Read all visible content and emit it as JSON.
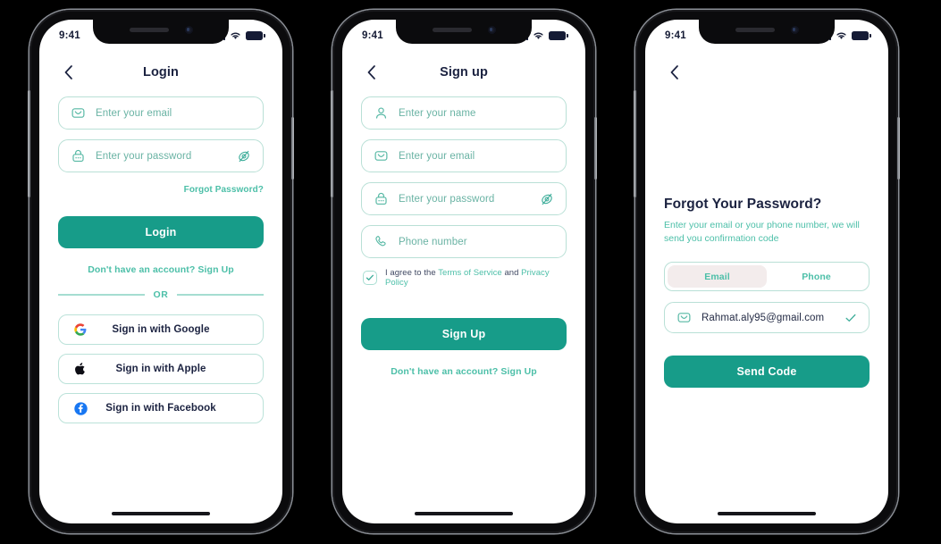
{
  "status_bar": {
    "time": "9:41",
    "signal_icon": "cellular-bars-icon",
    "wifi_icon": "wifi-icon",
    "battery_icon": "battery-icon"
  },
  "colors": {
    "primary": "#179C89",
    "link": "#4CBFA8",
    "placeholder": "#6AB3A4",
    "border": "#B9E0D6",
    "title": "#1B2240",
    "segment_active_bg": "#F3ECEC",
    "page_background": "#000000",
    "screen_background": "#FFFFFF"
  },
  "screens": [
    {
      "id": "login",
      "nav": {
        "back_icon": "chevron-left-icon",
        "title": "Login"
      },
      "fields": [
        {
          "name": "email",
          "icon": "envelope-icon",
          "placeholder": "Enter your email",
          "value": ""
        },
        {
          "name": "password",
          "icon": "lock-icon",
          "placeholder": "Enter your password",
          "value": "",
          "trailing_icon": "eye-off-icon"
        }
      ],
      "forgot_link": "Forgot Password?",
      "primary_button": "Login",
      "signup_link": "Don't have an account? Sign Up",
      "divider_label": "OR",
      "social_buttons": [
        {
          "icon": "google-icon",
          "label": "Sign in with Google"
        },
        {
          "icon": "apple-icon",
          "label": "Sign in with Apple"
        },
        {
          "icon": "facebook-icon",
          "label": "Sign in with Facebook"
        }
      ]
    },
    {
      "id": "signup",
      "nav": {
        "back_icon": "chevron-left-icon",
        "title": "Sign up"
      },
      "fields": [
        {
          "name": "name",
          "icon": "user-icon",
          "placeholder": "Enter your name",
          "value": ""
        },
        {
          "name": "email",
          "icon": "envelope-icon",
          "placeholder": "Enter your email",
          "value": ""
        },
        {
          "name": "password",
          "icon": "lock-icon",
          "placeholder": "Enter your password",
          "value": "",
          "trailing_icon": "eye-off-icon"
        },
        {
          "name": "phone",
          "icon": "phone-icon",
          "placeholder": "Phone number",
          "value": ""
        }
      ],
      "terms": {
        "checked": true,
        "prefix": "I agree to the ",
        "terms_link": "Terms of Service",
        "conjunction": " and ",
        "privacy_link": "Privacy Policy"
      },
      "primary_button": "Sign Up",
      "signup_link": "Don't have an account? Sign Up"
    },
    {
      "id": "forgot_password",
      "nav": {
        "back_icon": "chevron-left-icon",
        "title": ""
      },
      "title": "Forgot Your Password?",
      "subtitle": "Enter your email or your phone number, we will send you confirmation code",
      "segments": [
        {
          "label": "Email",
          "active": true
        },
        {
          "label": "Phone",
          "active": false
        }
      ],
      "email_field": {
        "icon": "envelope-icon",
        "value": "Rahmat.aly95@gmail.com",
        "trailing_icon": "check-icon"
      },
      "primary_button": "Send Code"
    }
  ]
}
